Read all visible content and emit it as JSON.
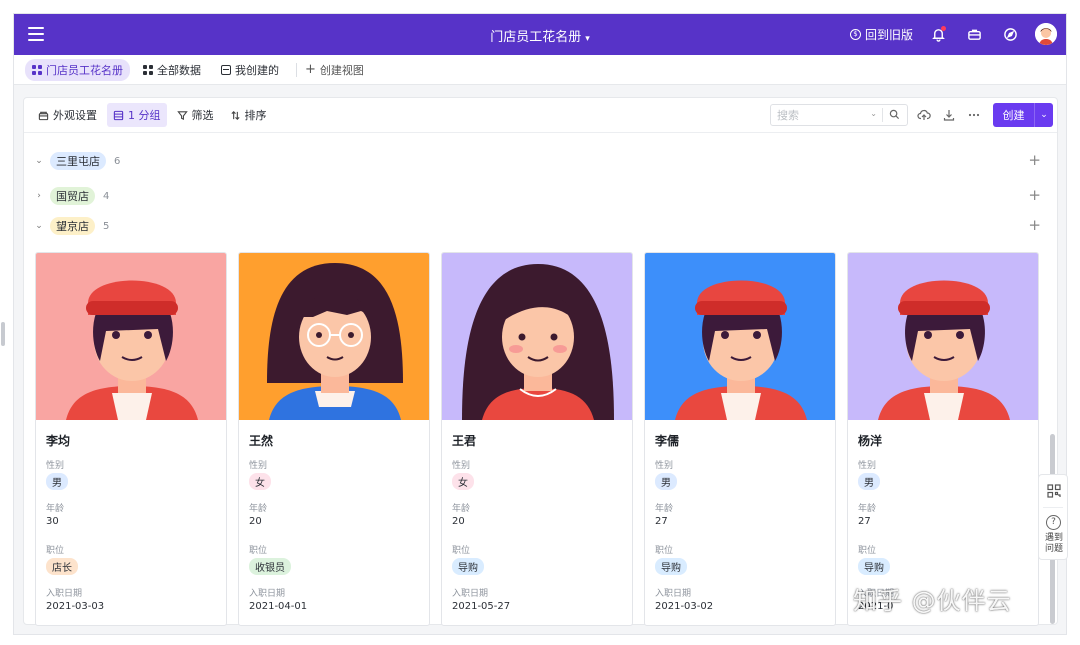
{
  "topbar": {
    "title": "门店员工花名册",
    "old_version": "回到旧版",
    "icons": [
      "menu-icon",
      "bell-icon",
      "briefcase-icon",
      "compass-icon",
      "user-avatar"
    ]
  },
  "views": {
    "tabs": [
      {
        "label": "门店员工花名册",
        "icon": "grid-icon",
        "active": true
      },
      {
        "label": "全部数据",
        "icon": "grid-icon",
        "active": false
      },
      {
        "label": "我创建的",
        "icon": "grid-icon",
        "active": false
      }
    ],
    "add_view": "创建视图"
  },
  "toolbar": {
    "appearance": "外观设置",
    "group": "1 分组",
    "filter": "筛选",
    "sort": "排序",
    "search_placeholder": "搜索",
    "create": "创建"
  },
  "groups": [
    {
      "name": "三里屯店",
      "count": "6",
      "expanded": true,
      "color": "#dceaff"
    },
    {
      "name": "国贸店",
      "count": "4",
      "expanded": false,
      "color": "#e1f3d8"
    },
    {
      "name": "望京店",
      "count": "5",
      "expanded": true,
      "color": "#fdf0c8"
    }
  ],
  "field_labels": {
    "gender": "性别",
    "age": "年龄",
    "position": "职位",
    "hire_date": "入职日期"
  },
  "cards": [
    {
      "name": "李均",
      "gender": "男",
      "age": "30",
      "position": "店长",
      "hire_date": "2021-03-03",
      "bg": "#f9a5a2"
    },
    {
      "name": "王然",
      "gender": "女",
      "age": "20",
      "position": "收银员",
      "hire_date": "2021-04-01",
      "bg": "#ff9f2e"
    },
    {
      "name": "王君",
      "gender": "女",
      "age": "20",
      "position": "导购",
      "hire_date": "2021-05-27",
      "bg": "#c7b9fb"
    },
    {
      "name": "李儒",
      "gender": "男",
      "age": "27",
      "position": "导购",
      "hire_date": "2021-03-02",
      "bg": "#3d8ffa"
    },
    {
      "name": "杨洋",
      "gender": "男",
      "age": "27",
      "position": "导购",
      "hire_date": "2021-0",
      "bg": "#c7b9fb"
    }
  ],
  "help": {
    "label": "遇到问题"
  },
  "watermark": "知乎 @伙伴云",
  "colors": {
    "brand": "#5733c8",
    "create_button": "#6a3bf0"
  }
}
